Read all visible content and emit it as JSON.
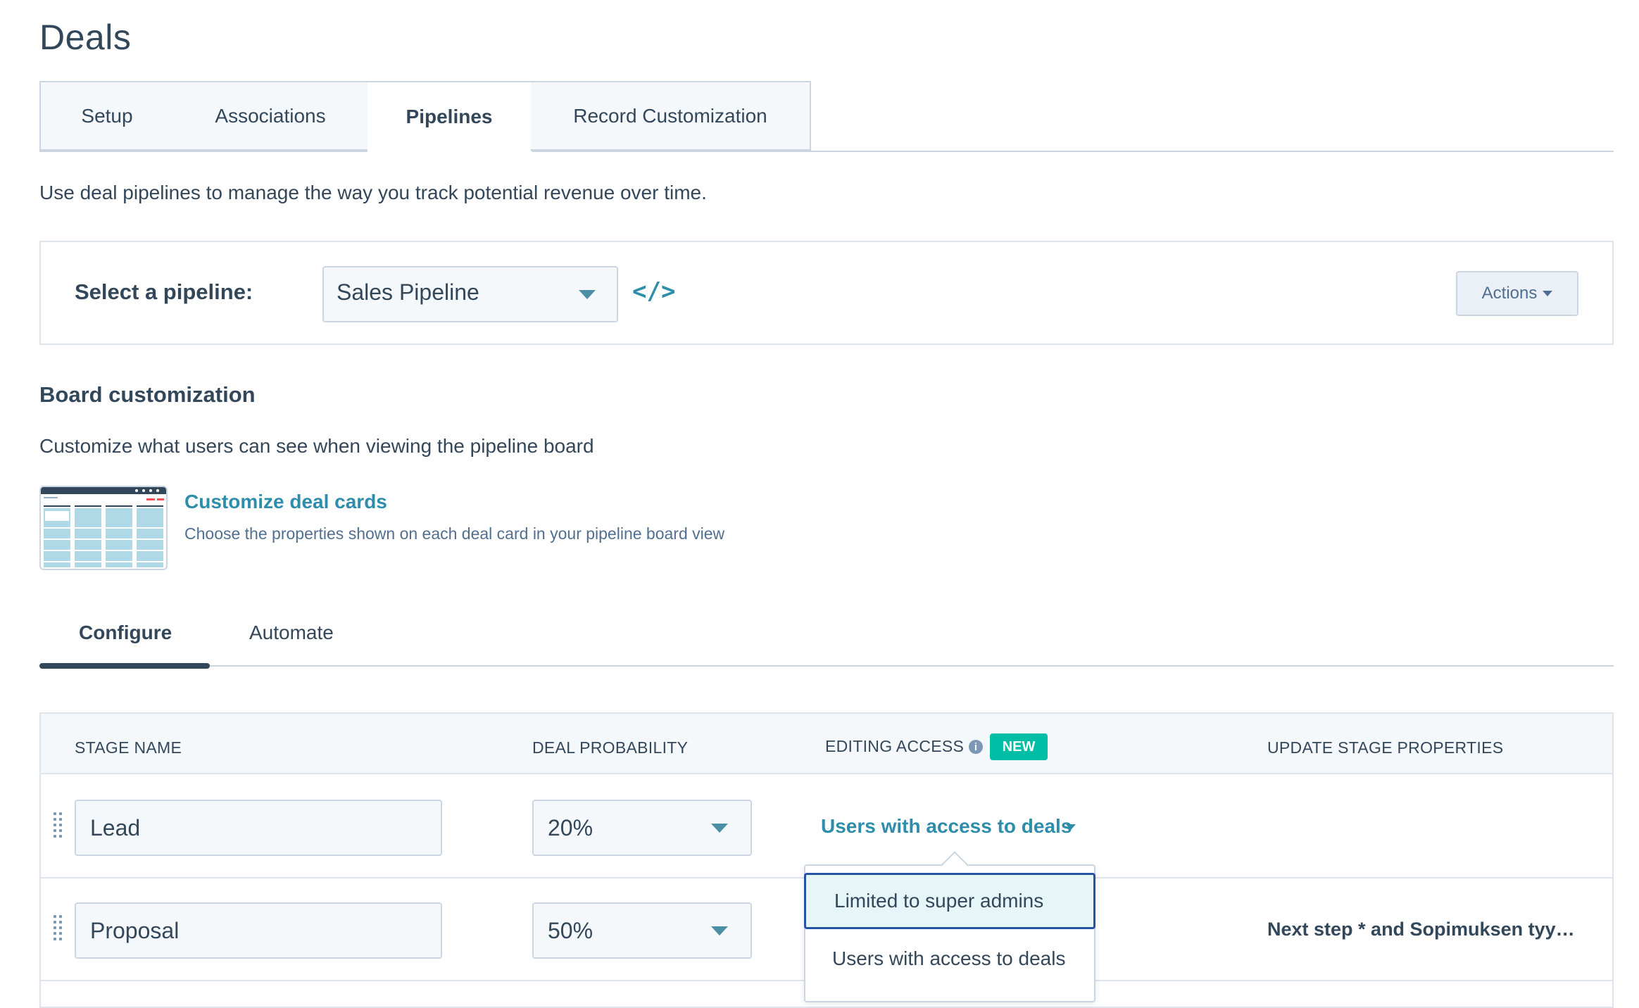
{
  "page": {
    "title": "Deals"
  },
  "tabs": [
    {
      "label": "Setup"
    },
    {
      "label": "Associations"
    },
    {
      "label": "Pipelines"
    },
    {
      "label": "Record Customization"
    }
  ],
  "intro_text": "Use deal pipelines to manage the way you track potential revenue over time.",
  "pipeline": {
    "label": "Select a pipeline:",
    "selected": "Sales Pipeline",
    "embed_icon": "code-icon",
    "actions_label": "Actions"
  },
  "board": {
    "title": "Board customization",
    "description": "Customize what users can see when viewing the pipeline board",
    "card_link": "Customize deal cards",
    "card_description": "Choose the properties shown on each deal card in your pipeline board view"
  },
  "subtabs": [
    {
      "label": "Configure"
    },
    {
      "label": "Automate"
    }
  ],
  "table": {
    "headers": {
      "stage_name": "STAGE NAME",
      "deal_probability": "DEAL PROBABILITY",
      "editing_access": "EDITING ACCESS",
      "new_badge": "NEW",
      "update_stage_properties": "UPDATE STAGE PROPERTIES"
    },
    "rows": [
      {
        "stage": "Lead",
        "probability": "20%",
        "access": "Users with access to deals",
        "properties": ""
      },
      {
        "stage": "Proposal",
        "probability": "50%",
        "access": "",
        "properties": "Next step * and Sopimuksen tyy…"
      }
    ]
  },
  "access_dropdown": {
    "options": [
      {
        "label": "Limited to super admins",
        "selected": true
      },
      {
        "label": "Users with access to deals",
        "selected": false
      }
    ]
  },
  "colors": {
    "accent": "#2e8dab",
    "badge": "#00bda5",
    "text": "#33475b",
    "selected_border": "#2455a4"
  }
}
